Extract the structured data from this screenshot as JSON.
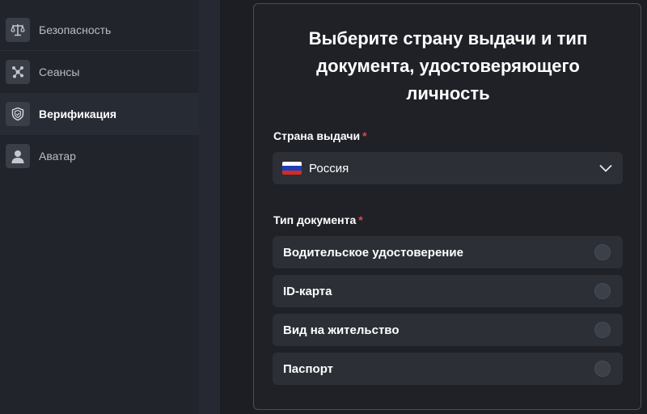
{
  "sidebar": {
    "items": [
      {
        "label": "Безопасность",
        "icon": "scales-icon"
      },
      {
        "label": "Сеансы",
        "icon": "sessions-icon"
      },
      {
        "label": "Верификация",
        "icon": "shield-icon",
        "active": true
      },
      {
        "label": "Аватар",
        "icon": "user-icon"
      }
    ]
  },
  "card": {
    "title": "Выберите страну выдачи и тип документа, удостоверяющего личность",
    "country": {
      "label": "Страна выдачи",
      "required_mark": "*",
      "value": "Россия",
      "flag_colors": [
        "#ffffff",
        "#1c3fb7",
        "#d52b1e"
      ]
    },
    "document_type": {
      "label": "Тип документа",
      "required_mark": "*",
      "options": [
        {
          "label": "Водительское удостоверение",
          "selected": false
        },
        {
          "label": "ID-карта",
          "selected": false
        },
        {
          "label": "Вид на жительство",
          "selected": false
        },
        {
          "label": "Паспорт",
          "selected": false
        }
      ]
    }
  },
  "colors": {
    "background": "#1c1e24",
    "sidebar": "#21242b",
    "field": "#2c2f36",
    "required": "#e0464a",
    "text": "#ffffff"
  }
}
